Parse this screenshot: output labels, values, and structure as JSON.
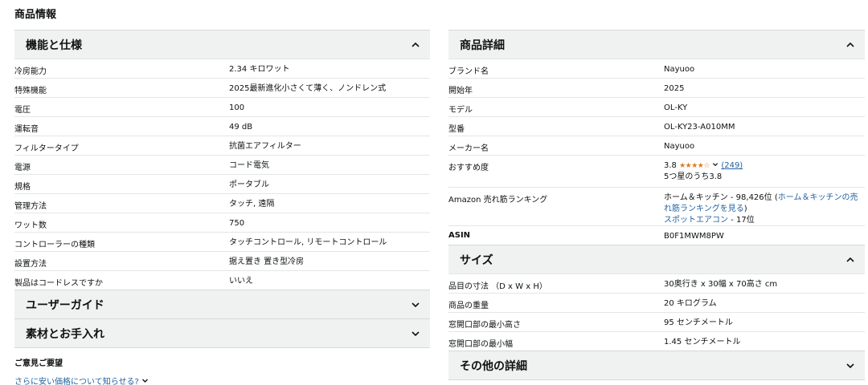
{
  "page_title": "商品情報",
  "left": {
    "features_section": {
      "title": "機能と仕様",
      "rows": [
        {
          "key": "冷房能力",
          "value": "2.34 キロワット"
        },
        {
          "key": "特殊機能",
          "value": "2025最新進化小さくて薄く、ノンドレン式"
        },
        {
          "key": "電圧",
          "value": "100"
        },
        {
          "key": "運転音",
          "value": "49 dB"
        },
        {
          "key": "フィルタータイプ",
          "value": "抗菌エアフィルター"
        },
        {
          "key": "電源",
          "value": "コード電気"
        },
        {
          "key": "規格",
          "value": "ポータブル"
        },
        {
          "key": "管理方法",
          "value": "タッチ, 遠隔"
        },
        {
          "key": "ワット数",
          "value": "750"
        },
        {
          "key": "コントローラーの種類",
          "value": "タッチコントロール, リモートコントロール"
        },
        {
          "key": "設置方法",
          "value": "据え置き 置き型冷房"
        },
        {
          "key": "製品はコードレスですか",
          "value": "いいえ"
        }
      ]
    },
    "user_guide_title": "ユーザーガイド",
    "care_title": "素材とお手入れ",
    "feedback": {
      "title": "ご意見ご要望",
      "link": "さらに安い価格について知らせる?"
    }
  },
  "right": {
    "details_section": {
      "title": "商品詳細",
      "brand": {
        "key": "ブランド名",
        "value": "Nayuoo"
      },
      "year": {
        "key": "開始年",
        "value": "2025"
      },
      "model": {
        "key": "モデル",
        "value": "OL-KY"
      },
      "model_number": {
        "key": "型番",
        "value": "OL-KY23-A010MM"
      },
      "maker": {
        "key": "メーカー名",
        "value": "Nayuoo"
      },
      "rating": {
        "key": "おすすめ度",
        "score": "3.8",
        "stars": "★★★★☆",
        "count": "(249)",
        "summary": "5つ星のうち3.8",
        "rating_value": 3.8
      },
      "ranking": {
        "key": "Amazon 売れ筋ランキング",
        "line1_prefix": "ホーム＆キッチン - 98,426位 (",
        "line1_link": "ホーム＆キッチンの売れ筋ランキングを見る",
        "line1_suffix": ")",
        "line2_link": "スポットエアコン",
        "line2_suffix": " - 17位"
      },
      "asin": {
        "key": "ASIN",
        "value": "B0F1MWM8PW"
      }
    },
    "size_section": {
      "title": "サイズ",
      "rows": [
        {
          "key": "品目の寸法 （D x W x H）",
          "value": "30奥行き x 30幅 x 70高さ cm"
        },
        {
          "key": "商品の重量",
          "value": "20 キログラム"
        },
        {
          "key": "窓開口部の最小高さ",
          "value": "95 センチメートル"
        },
        {
          "key": "窓開口部の最小幅",
          "value": "1.45 センチメートル"
        }
      ]
    },
    "other_title": "その他の詳細"
  },
  "icons": {
    "expanded": "chevron-up-icon",
    "collapsed": "chevron-down-icon"
  }
}
